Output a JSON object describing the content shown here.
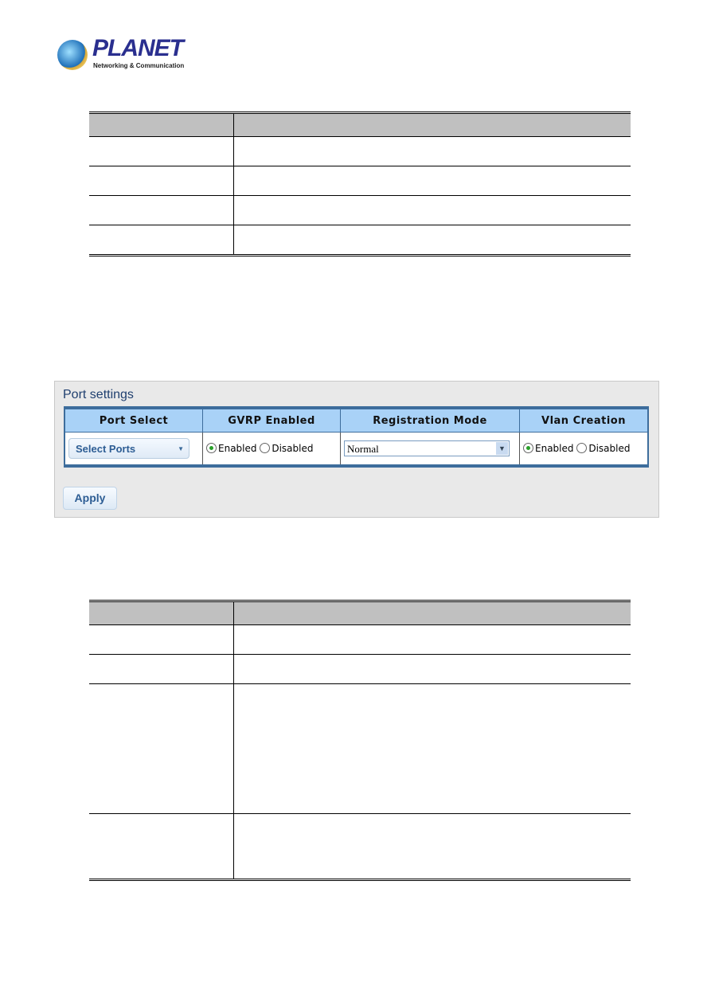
{
  "logo": {
    "brand": "PLANET",
    "tagline": "Networking & Communication"
  },
  "port_settings": {
    "title": "Port settings",
    "columns": [
      "Port Select",
      "GVRP Enabled",
      "Registration Mode",
      "Vlan Creation"
    ],
    "port_select": "Select Ports",
    "gvrp": {
      "enabled_label": "Enabled",
      "disabled_label": "Disabled",
      "selected": "Enabled"
    },
    "registration_mode": "Normal",
    "vlan_creation": {
      "enabled_label": "Enabled",
      "disabled_label": "Disabled",
      "selected": "Enabled"
    },
    "apply_label": "Apply"
  }
}
